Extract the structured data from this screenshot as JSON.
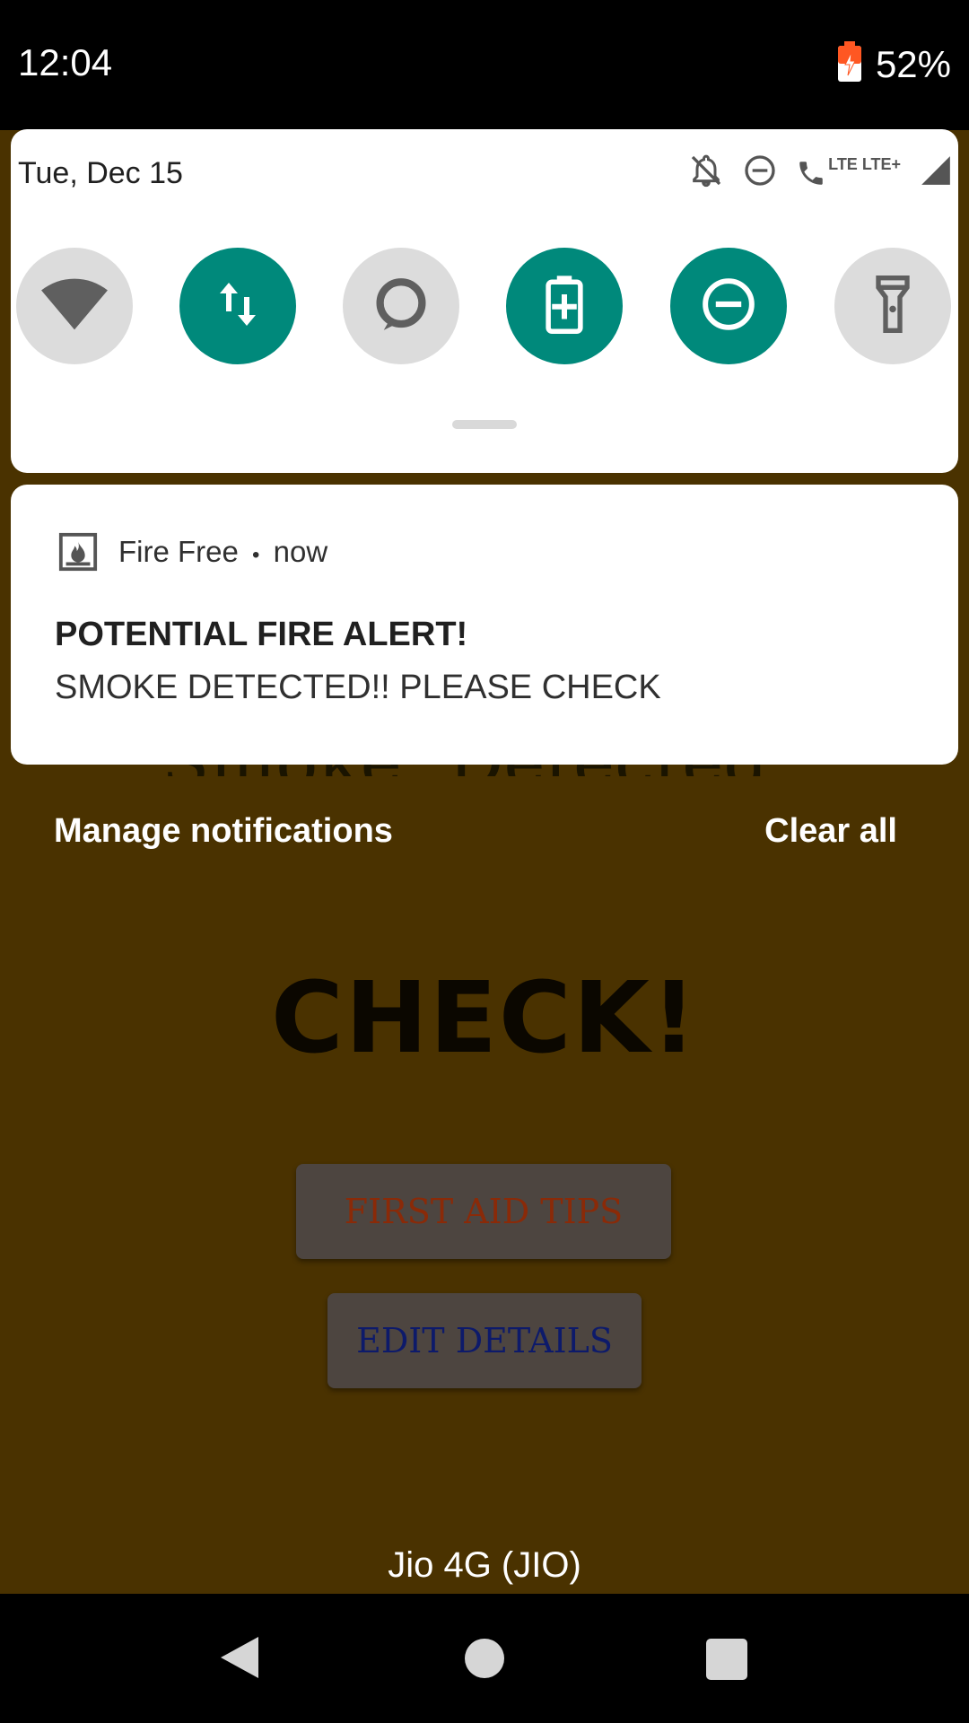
{
  "status_bar": {
    "time": "12:04",
    "battery": "52%"
  },
  "quick_settings": {
    "date": "Tue, Dec 15",
    "lte_label": "LTE LTE+",
    "tiles": [
      {
        "icon": "wifi-icon",
        "state": "off"
      },
      {
        "icon": "mobile-data-icon",
        "state": "on"
      },
      {
        "icon": "alexa-icon",
        "state": "off"
      },
      {
        "icon": "battery-saver-icon",
        "state": "on"
      },
      {
        "icon": "do-not-disturb-icon",
        "state": "on"
      },
      {
        "icon": "flashlight-icon",
        "state": "off"
      }
    ]
  },
  "notification": {
    "app_name": "Fire Free",
    "separator": "•",
    "time": "now",
    "title": "POTENTIAL FIRE ALERT!",
    "text": "SMOKE DETECTED!! PLEASE CHECK"
  },
  "shade_actions": {
    "manage": "Manage notifications",
    "clear": "Clear all"
  },
  "app": {
    "smoke_label": "Smoke: Detected",
    "status_heading": "CHECK!",
    "first_aid_button": "FIRST AID TIPS",
    "edit_button": "EDIT DETAILS"
  },
  "network": "Jio 4G (JIO)",
  "colors": {
    "accent": "#00897b",
    "app_background": "#4a3200"
  }
}
